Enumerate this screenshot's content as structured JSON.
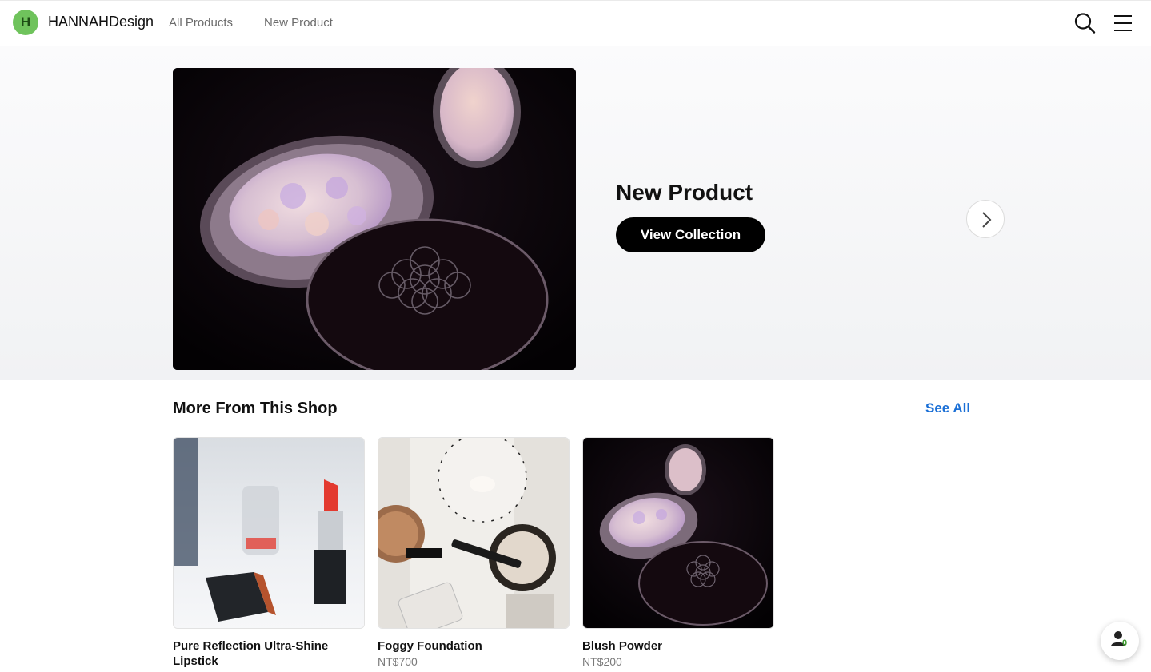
{
  "header": {
    "logo_letter": "H",
    "brand": "HANNAHDesign",
    "nav": [
      "All Products",
      "New Product"
    ],
    "icons": [
      "search-icon",
      "hamburger-menu-icon"
    ]
  },
  "hero": {
    "image": "meteorites-powder-photo",
    "title": "New Product",
    "cta": "View Collection",
    "next_icon": "chevron-right-icon"
  },
  "shop": {
    "title": "More From This Shop",
    "see_all": "See All",
    "products": [
      {
        "name": "Pure Reflection Ultra-Shine Lipstick",
        "price": "",
        "image": "lipstick-photo"
      },
      {
        "name": "Foggy Foundation",
        "price": "NT$700",
        "image": "foundation-flatlay-photo"
      },
      {
        "name": "Blush Powder",
        "price": "NT$200",
        "image": "meteorites-powder-photo"
      }
    ]
  },
  "fab": {
    "icon": "person-icon",
    "count": "0"
  },
  "colors": {
    "accent": "#1a6fd6",
    "logo_bg": "#6fc35c",
    "cta_bg": "#000000"
  }
}
